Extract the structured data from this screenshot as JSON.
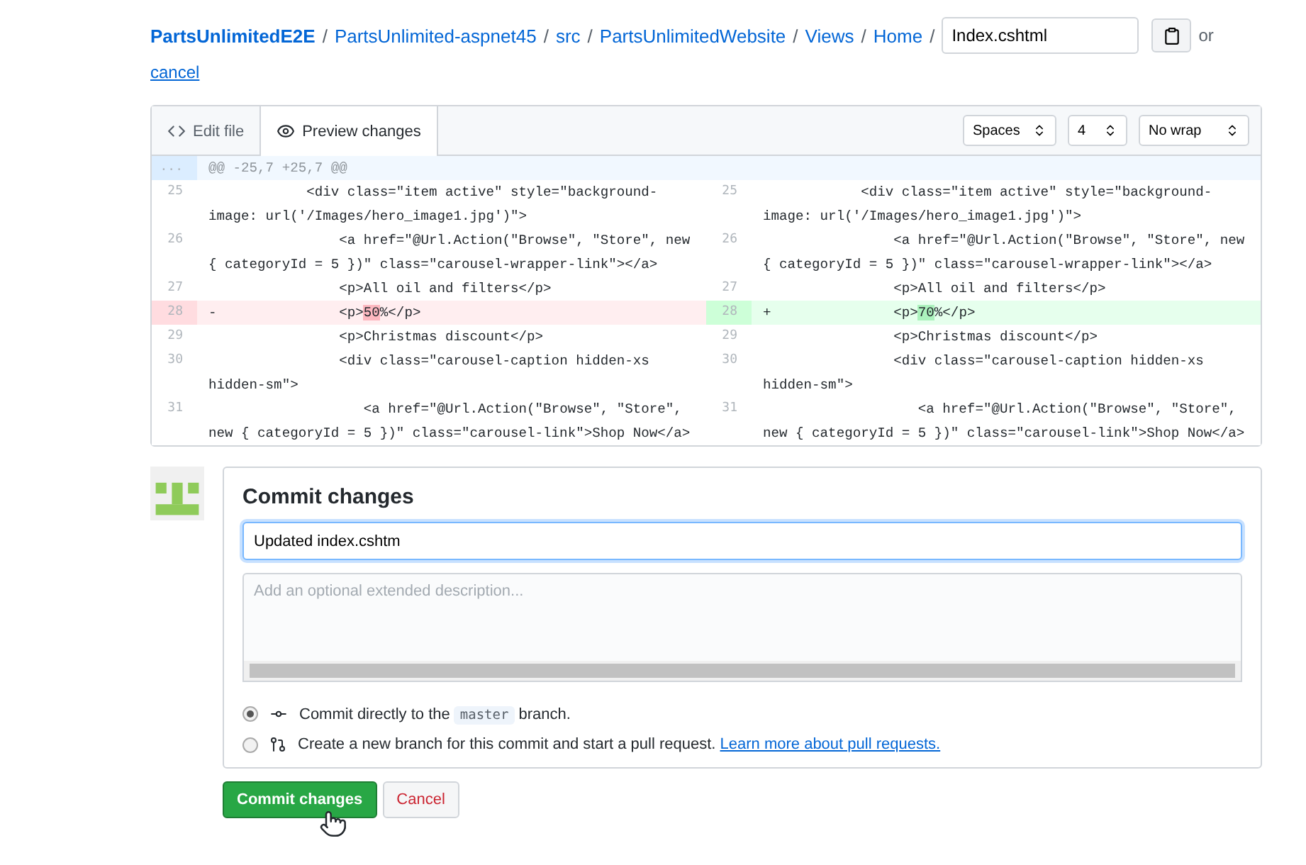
{
  "breadcrumb": [
    {
      "label": "PartsUnlimitedE2E",
      "bold": true,
      "separator": "/"
    },
    {
      "label": "PartsUnlimited-aspnet45",
      "bold": false,
      "separator": "/"
    },
    {
      "label": "src",
      "bold": false,
      "separator": "/"
    },
    {
      "label": "PartsUnlimitedWebsite",
      "bold": false,
      "separator": "/"
    },
    {
      "label": "Views",
      "bold": false,
      "separator": "/"
    },
    {
      "label": "Home",
      "bold": false,
      "separator": "/"
    }
  ],
  "filename": {
    "value": "Index.cshtml"
  },
  "or_text": "or",
  "cancel_link": "cancel",
  "tabs": [
    {
      "label": "Edit file",
      "selected": false
    },
    {
      "label": "Preview changes",
      "selected": true
    }
  ],
  "selects": [
    "Spaces",
    "4",
    "No wrap"
  ],
  "diff": {
    "hunk_marker": "...",
    "hunk": "@@ -25,7 +25,7 @@",
    "left": [
      {
        "number": "25",
        "kind": "context",
        "code": "            <div class=\"item active\" style=\"background-image: url('/Images/hero_image1.jpg')\">"
      },
      {
        "number": "26",
        "kind": "context",
        "code": "                <a href=\"@Url.Action(\"Browse\", \"Store\", new { categoryId = 5 })\" class=\"carousel-wrapper-link\"></a>"
      },
      {
        "number": "27",
        "kind": "context",
        "code": "                <p>All oil and filters</p>"
      },
      {
        "number": "28",
        "kind": "deletion",
        "marker": "-",
        "code": "               <p>",
        "changed": "50",
        "rest": "%</p>"
      },
      {
        "number": "29",
        "kind": "context",
        "code": "                <p>Christmas discount</p>"
      },
      {
        "number": "30",
        "kind": "context",
        "code": "                <div class=\"carousel-caption hidden-xs hidden-sm\">"
      },
      {
        "number": "31",
        "kind": "context",
        "code": "                   <a href=\"@Url.Action(\"Browse\", \"Store\", new { categoryId = 5 })\" class=\"carousel-link\">Shop Now</a>"
      }
    ],
    "right": [
      {
        "number": "25",
        "kind": "context",
        "code": "            <div class=\"item active\" style=\"background-image: url('/Images/hero_image1.jpg')\">"
      },
      {
        "number": "26",
        "kind": "context",
        "code": "                <a href=\"@Url.Action(\"Browse\", \"Store\", new { categoryId = 5 })\" class=\"carousel-wrapper-link\"></a>"
      },
      {
        "number": "27",
        "kind": "context",
        "code": "                <p>All oil and filters</p>"
      },
      {
        "number": "28",
        "kind": "addition",
        "marker": "+",
        "code": "               <p>",
        "changed": "70",
        "rest": "%</p>"
      },
      {
        "number": "29",
        "kind": "context",
        "code": "                <p>Christmas discount</p>"
      },
      {
        "number": "30",
        "kind": "context",
        "code": "                <div class=\"carousel-caption hidden-xs hidden-sm\">"
      },
      {
        "number": "31",
        "kind": "context",
        "code": "                   <a href=\"@Url.Action(\"Browse\", \"Store\", new { categoryId = 5 })\" class=\"carousel-link\">Shop Now</a>"
      }
    ]
  },
  "commit": {
    "title": "Commit changes",
    "summary": {
      "value": "Updated index.cshtm"
    },
    "description": {
      "placeholder": "Add an optional extended description..."
    },
    "options": [
      {
        "selected": true,
        "before": "Commit directly to the",
        "branch": "master",
        "after": "branch."
      },
      {
        "selected": false,
        "before": "Create a new branch for this commit and start a pull request.",
        "link": "Learn more about pull requests."
      }
    ],
    "buttons": [
      {
        "label": "Commit changes",
        "kind": "primary"
      },
      {
        "label": "Cancel",
        "kind": "danger"
      }
    ]
  }
}
